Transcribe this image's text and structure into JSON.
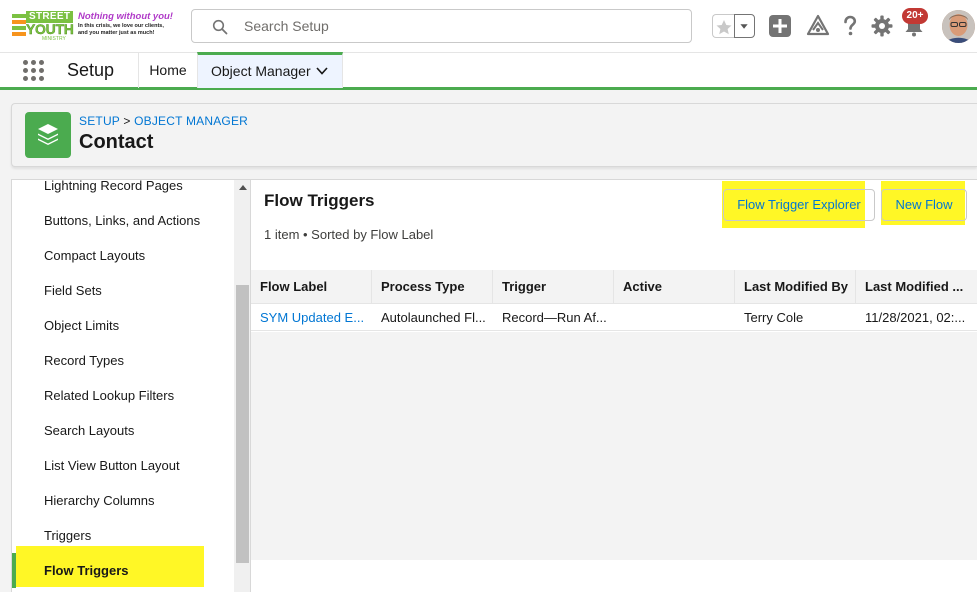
{
  "header": {
    "logo": {
      "street": "STREET",
      "youth": "YOUTH",
      "ministry": "MINISTRY",
      "tagline": "Nothing without you!",
      "subtext": "In this crisis, we love our clients, and you matter just as much!"
    },
    "search": {
      "placeholder": "Search Setup",
      "value": ""
    },
    "notifications_badge": "20+",
    "icons": [
      "star-icon",
      "chevron-down-icon",
      "plus-icon",
      "trailhead-icon",
      "help-icon",
      "gear-icon",
      "bell-icon"
    ]
  },
  "nav": {
    "app_name": "Setup",
    "tabs": [
      {
        "label": "Home"
      },
      {
        "label": "Object Manager"
      }
    ]
  },
  "object_header": {
    "breadcrumb": [
      "SETUP",
      "OBJECT MANAGER"
    ],
    "breadcrumb_separator": ">",
    "title": "Contact"
  },
  "sidebar": {
    "items": [
      {
        "label": "Lightning Record Pages"
      },
      {
        "label": "Buttons, Links, and Actions"
      },
      {
        "label": "Compact Layouts"
      },
      {
        "label": "Field Sets"
      },
      {
        "label": "Object Limits"
      },
      {
        "label": "Record Types"
      },
      {
        "label": "Related Lookup Filters"
      },
      {
        "label": "Search Layouts"
      },
      {
        "label": "List View Button Layout"
      },
      {
        "label": "Hierarchy Columns"
      },
      {
        "label": "Triggers"
      },
      {
        "label": "Flow Triggers",
        "active": true
      }
    ]
  },
  "main": {
    "title": "Flow Triggers",
    "subtitle": "1 item • Sorted by Flow Label",
    "buttons": {
      "explorer": "Flow Trigger Explorer",
      "new_flow": "New Flow"
    },
    "table": {
      "columns": [
        "Flow Label",
        "Process Type",
        "Trigger",
        "Active",
        "Last Modified By",
        "Last Modified ..."
      ],
      "rows": [
        [
          "SYM Updated E...",
          "Autolaunched Fl...",
          "Record—Run Af...",
          "",
          "Terry Cole",
          "11/28/2021, 02:..."
        ]
      ]
    }
  },
  "colors": {
    "brand_green": "#4bab4f",
    "link_blue": "#0176d3",
    "highlight_yellow": "#fff600",
    "badge_red": "#c23934"
  }
}
